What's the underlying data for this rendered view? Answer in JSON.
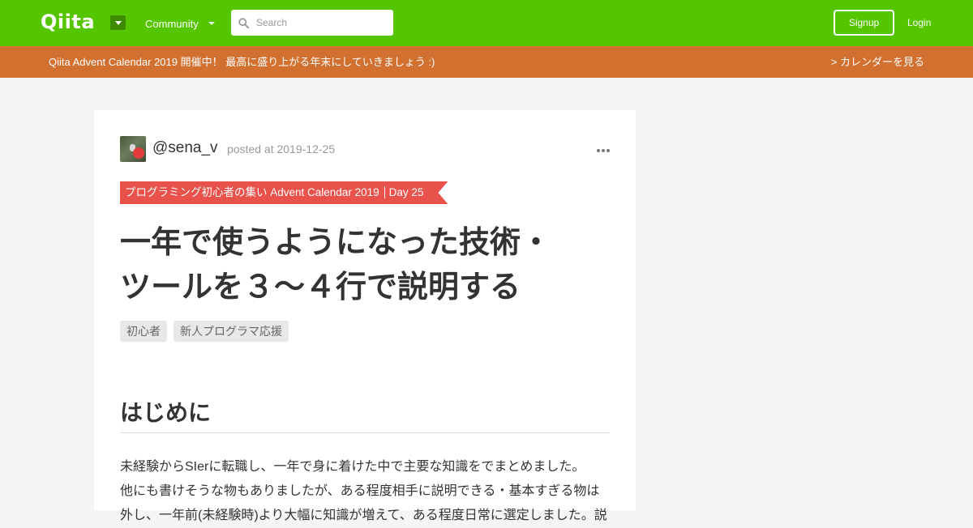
{
  "navbar": {
    "logo": "Qiita",
    "community_label": "Community",
    "search_placeholder": "Search",
    "signup_label": "Signup",
    "login_label": "Login"
  },
  "banner": {
    "text": "Qiita Advent Calendar 2019 開催中！ 最高に盛り上がる年末にしていきましょう :)",
    "link": "> カレンダーを見る"
  },
  "article": {
    "author": "@sena_v",
    "posted": "posted at 2019-12-25",
    "advent_calendar": "プログラミング初心者の集い Advent Calendar 2019",
    "advent_day": "Day 25",
    "title_line1": "一年で使うようになった技術・",
    "title_line2": "ツールを３〜４行で説明する",
    "tags": [
      "初心者",
      "新人プログラマ応援"
    ],
    "heading": "はじめに",
    "paragraph_line1": "未経験からSIerに転職し、一年で身に着けた中で主要な知識をでまとめました。",
    "paragraph_line2": "他にも書けそうな物もありましたが、ある程度相手に説明できる・基本すぎる物は",
    "paragraph_line3": "外し、一年前(未経験時)より大幅に知識が増えて、ある程度日常に選定しました。説"
  },
  "colors": {
    "navbar": "#55c500",
    "banner": "#d2702f",
    "advent_ribbon": "#e9524a",
    "background": "#f5f5f4"
  }
}
